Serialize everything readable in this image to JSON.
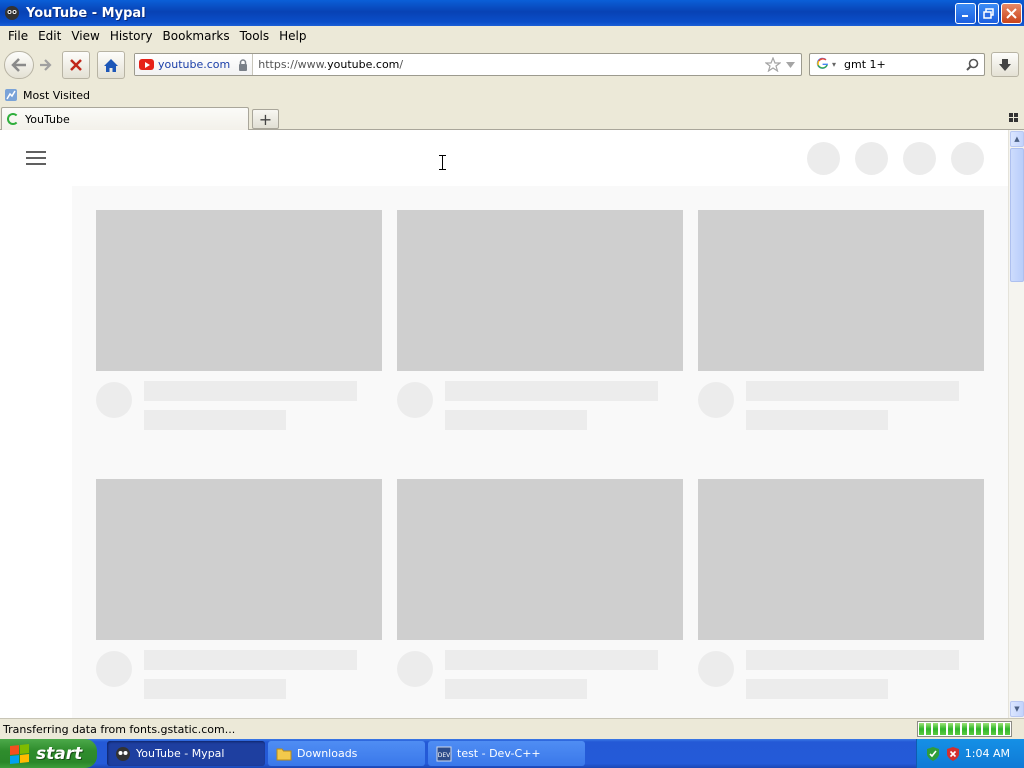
{
  "window": {
    "title": "YouTube - Mypal",
    "controls": {
      "minimize": "_",
      "maximize": "❐",
      "close": "✕"
    }
  },
  "menu": [
    "File",
    "Edit",
    "View",
    "History",
    "Bookmarks",
    "Tools",
    "Help"
  ],
  "navigation": {
    "site_identity": "youtube.com",
    "url_prefix": "https://www.",
    "url_domain": "youtube.com",
    "url_suffix": "/",
    "search_engine_icon": "google-icon",
    "search_query": "gmt 1+"
  },
  "bookmarks": {
    "items": [
      "Most Visited"
    ]
  },
  "tabs": [
    {
      "label": "YouTube",
      "loading": true
    }
  ],
  "new_tab_symbol": "+",
  "status": {
    "text": "Transferring data from fonts.gstatic.com...",
    "progress_segments": 13
  },
  "taskbar": {
    "start_label": "start",
    "tasks": [
      {
        "label": "YouTube - Mypal",
        "active": true,
        "icon": "mypal-icon"
      },
      {
        "label": "Downloads",
        "active": false,
        "icon": "folder-icon"
      },
      {
        "label": "test - Dev-C++",
        "active": false,
        "icon": "devcpp-icon"
      }
    ],
    "clock": "1:04 AM"
  },
  "colors": {
    "titlebar": "#0842b4",
    "chrome": "#ece9d8",
    "placeholder_thumb": "#cfcfcf",
    "placeholder_light": "#ececec",
    "youtube_red": "#e62117"
  }
}
